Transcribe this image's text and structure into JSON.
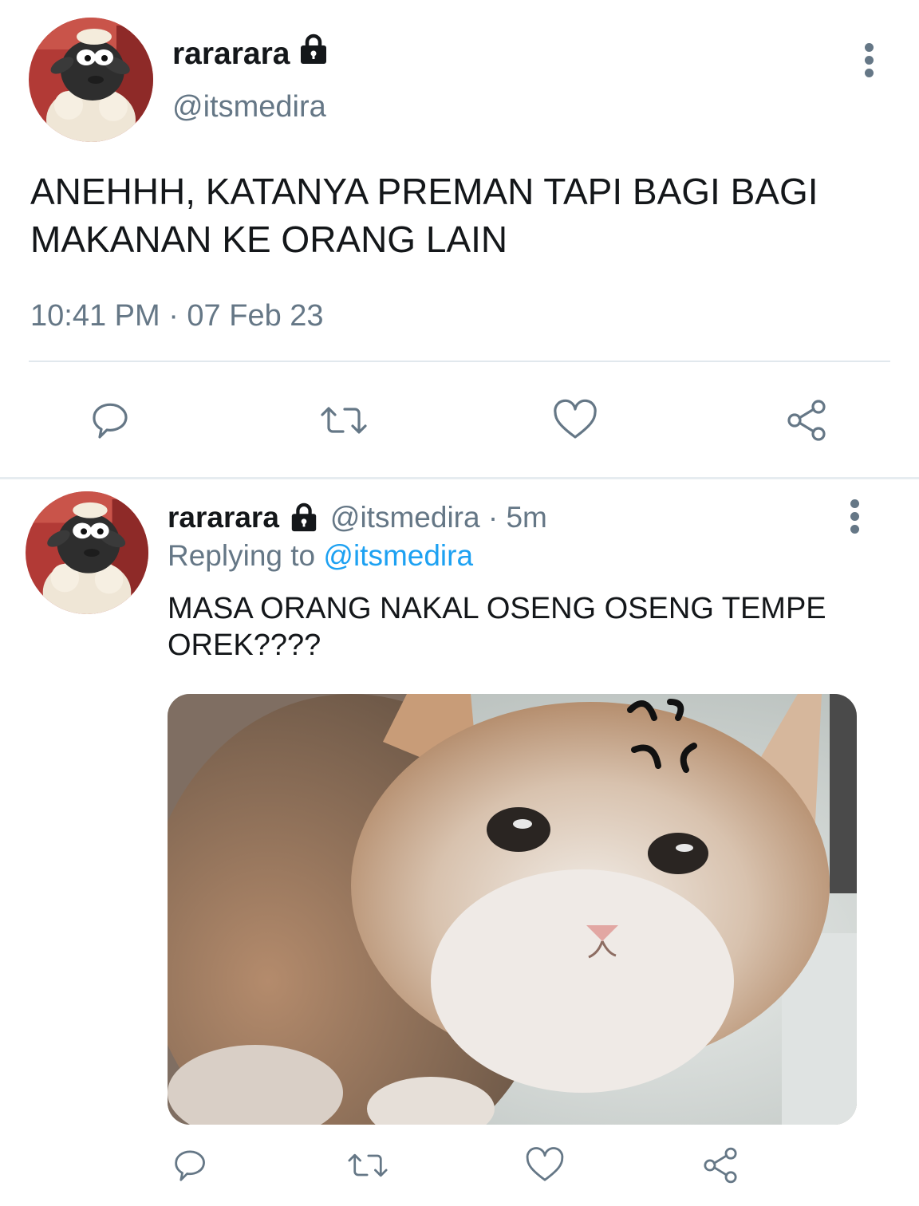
{
  "main_tweet": {
    "display_name": "rararara",
    "handle": "@itsmedira",
    "text": "ANEHHH, KATANYA PREMAN TAPI BAGI BAGI MAKANAN KE ORANG LAIN",
    "timestamp": "10:41 PM · 07 Feb 23",
    "icons": {
      "lock": "lock-icon",
      "more": "more-vertical-icon"
    },
    "actions": [
      "reply-icon",
      "retweet-icon",
      "like-icon",
      "share-icon"
    ]
  },
  "reply_tweet": {
    "display_name": "rararara",
    "handle_time": "@itsmedira · 5m",
    "replying_prefix": "Replying to",
    "replying_mention": "@itsmedira",
    "text": "MASA ORANG NAKAL OSENG OSENG TEMPE OREK????",
    "media": "cat-photo",
    "actions": [
      "reply-icon",
      "retweet-icon",
      "like-icon",
      "share-icon"
    ]
  },
  "colors": {
    "text": "#14171a",
    "secondary": "#657786",
    "accent": "#1da1f2",
    "divider": "#e1e8ed"
  }
}
